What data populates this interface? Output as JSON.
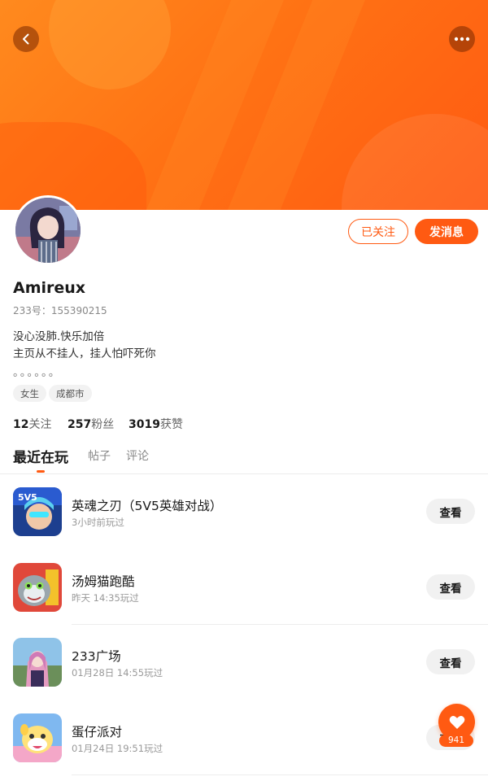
{
  "profile": {
    "name": "Amireux",
    "id_text": "233号：155390215",
    "bio": [
      "没心没肺.快乐加倍",
      "主页从不挂人，挂人怕吓死你",
      "。。。。。。"
    ],
    "tags": [
      "女生",
      "成都市"
    ]
  },
  "actions": {
    "followed_label": "已关注",
    "message_label": "发消息"
  },
  "stats": [
    {
      "value": "12",
      "label": "关注"
    },
    {
      "value": "257",
      "label": "粉丝"
    },
    {
      "value": "3019",
      "label": "获赞"
    }
  ],
  "tabs": [
    "最近在玩",
    "帖子",
    "评论"
  ],
  "games": [
    {
      "title": "英魂之刃（5V5英雄对战）",
      "time": "3小时前玩过",
      "button": "查看"
    },
    {
      "title": "汤姆猫跑酷",
      "time": "昨天 14:35玩过",
      "button": "查看"
    },
    {
      "title": "233广场",
      "time": "01月28日 14:55玩过",
      "button": "查看"
    },
    {
      "title": "蛋仔派对",
      "time": "01月24日 19:51玩过",
      "button": "查看"
    }
  ],
  "like": {
    "count": "941"
  },
  "icons": {
    "back": "chevron-left-icon",
    "more": "more-horizontal-icon",
    "like": "heart-icon"
  },
  "colors": {
    "accent": "#ff5a12",
    "banner": "#ff7214"
  }
}
